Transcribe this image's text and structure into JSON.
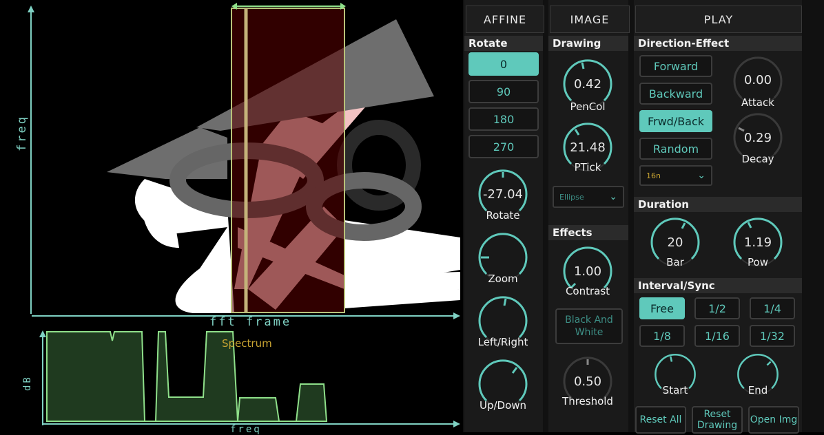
{
  "viz": {
    "freq_axis_label": "freq",
    "fft_axis_label": "fft frame",
    "db_axis_label": "dB",
    "spectrum_axis_label": "freq",
    "spectrum_title": "Spectrum"
  },
  "tabs": {
    "affine": "AFFINE",
    "image": "IMAGE",
    "play": "PLAY"
  },
  "affine": {
    "section": "Rotate",
    "rotate_buttons": [
      "0",
      "90",
      "180",
      "270"
    ],
    "active_rotate": "0",
    "knobs": [
      {
        "value": "-27.04",
        "label": "Rotate"
      },
      {
        "value": "",
        "label": "Zoom"
      },
      {
        "value": "",
        "label": "Left/Right"
      },
      {
        "value": "",
        "label": "Up/Down"
      }
    ]
  },
  "image": {
    "drawing_section": "Drawing",
    "pencol": {
      "value": "0.42",
      "label": "PenCol"
    },
    "ptick": {
      "value": "21.48",
      "label": "PTick"
    },
    "shape_select": "Ellipse",
    "effects_section": "Effects",
    "contrast": {
      "value": "1.00",
      "label": "Contrast"
    },
    "bw_button": "Black And White",
    "threshold": {
      "value": "0.50",
      "label": "Threshold"
    }
  },
  "play": {
    "direction_section": "Direction-Effect",
    "direction_buttons": [
      "Forward",
      "Backward",
      "Frwd/Back",
      "Random"
    ],
    "active_direction": "Frwd/Back",
    "attack": {
      "value": "0.00",
      "label": "Attack"
    },
    "decay": {
      "value": "0.29",
      "label": "Decay"
    },
    "note_select": "16n",
    "duration_section": "Duration",
    "bar": {
      "value": "20",
      "label": "Bar"
    },
    "pow": {
      "value": "1.19",
      "label": "Pow"
    },
    "interval_section": "Interval/Sync",
    "interval_buttons": [
      "Free",
      "1/2",
      "1/4",
      "1/8",
      "1/16",
      "1/32"
    ],
    "active_interval": "Free",
    "start": {
      "label": "Start"
    },
    "end": {
      "label": "End"
    },
    "bottom_buttons": [
      "Reset All",
      "Reset Drawing",
      "Open Img"
    ]
  },
  "colors": {
    "accent": "#5fc9bb",
    "panel": "#1a1a1a",
    "spectrum_fill": "#1f3a1f",
    "spectrum_line": "#8fe08a",
    "highlight": "#c9a432"
  }
}
